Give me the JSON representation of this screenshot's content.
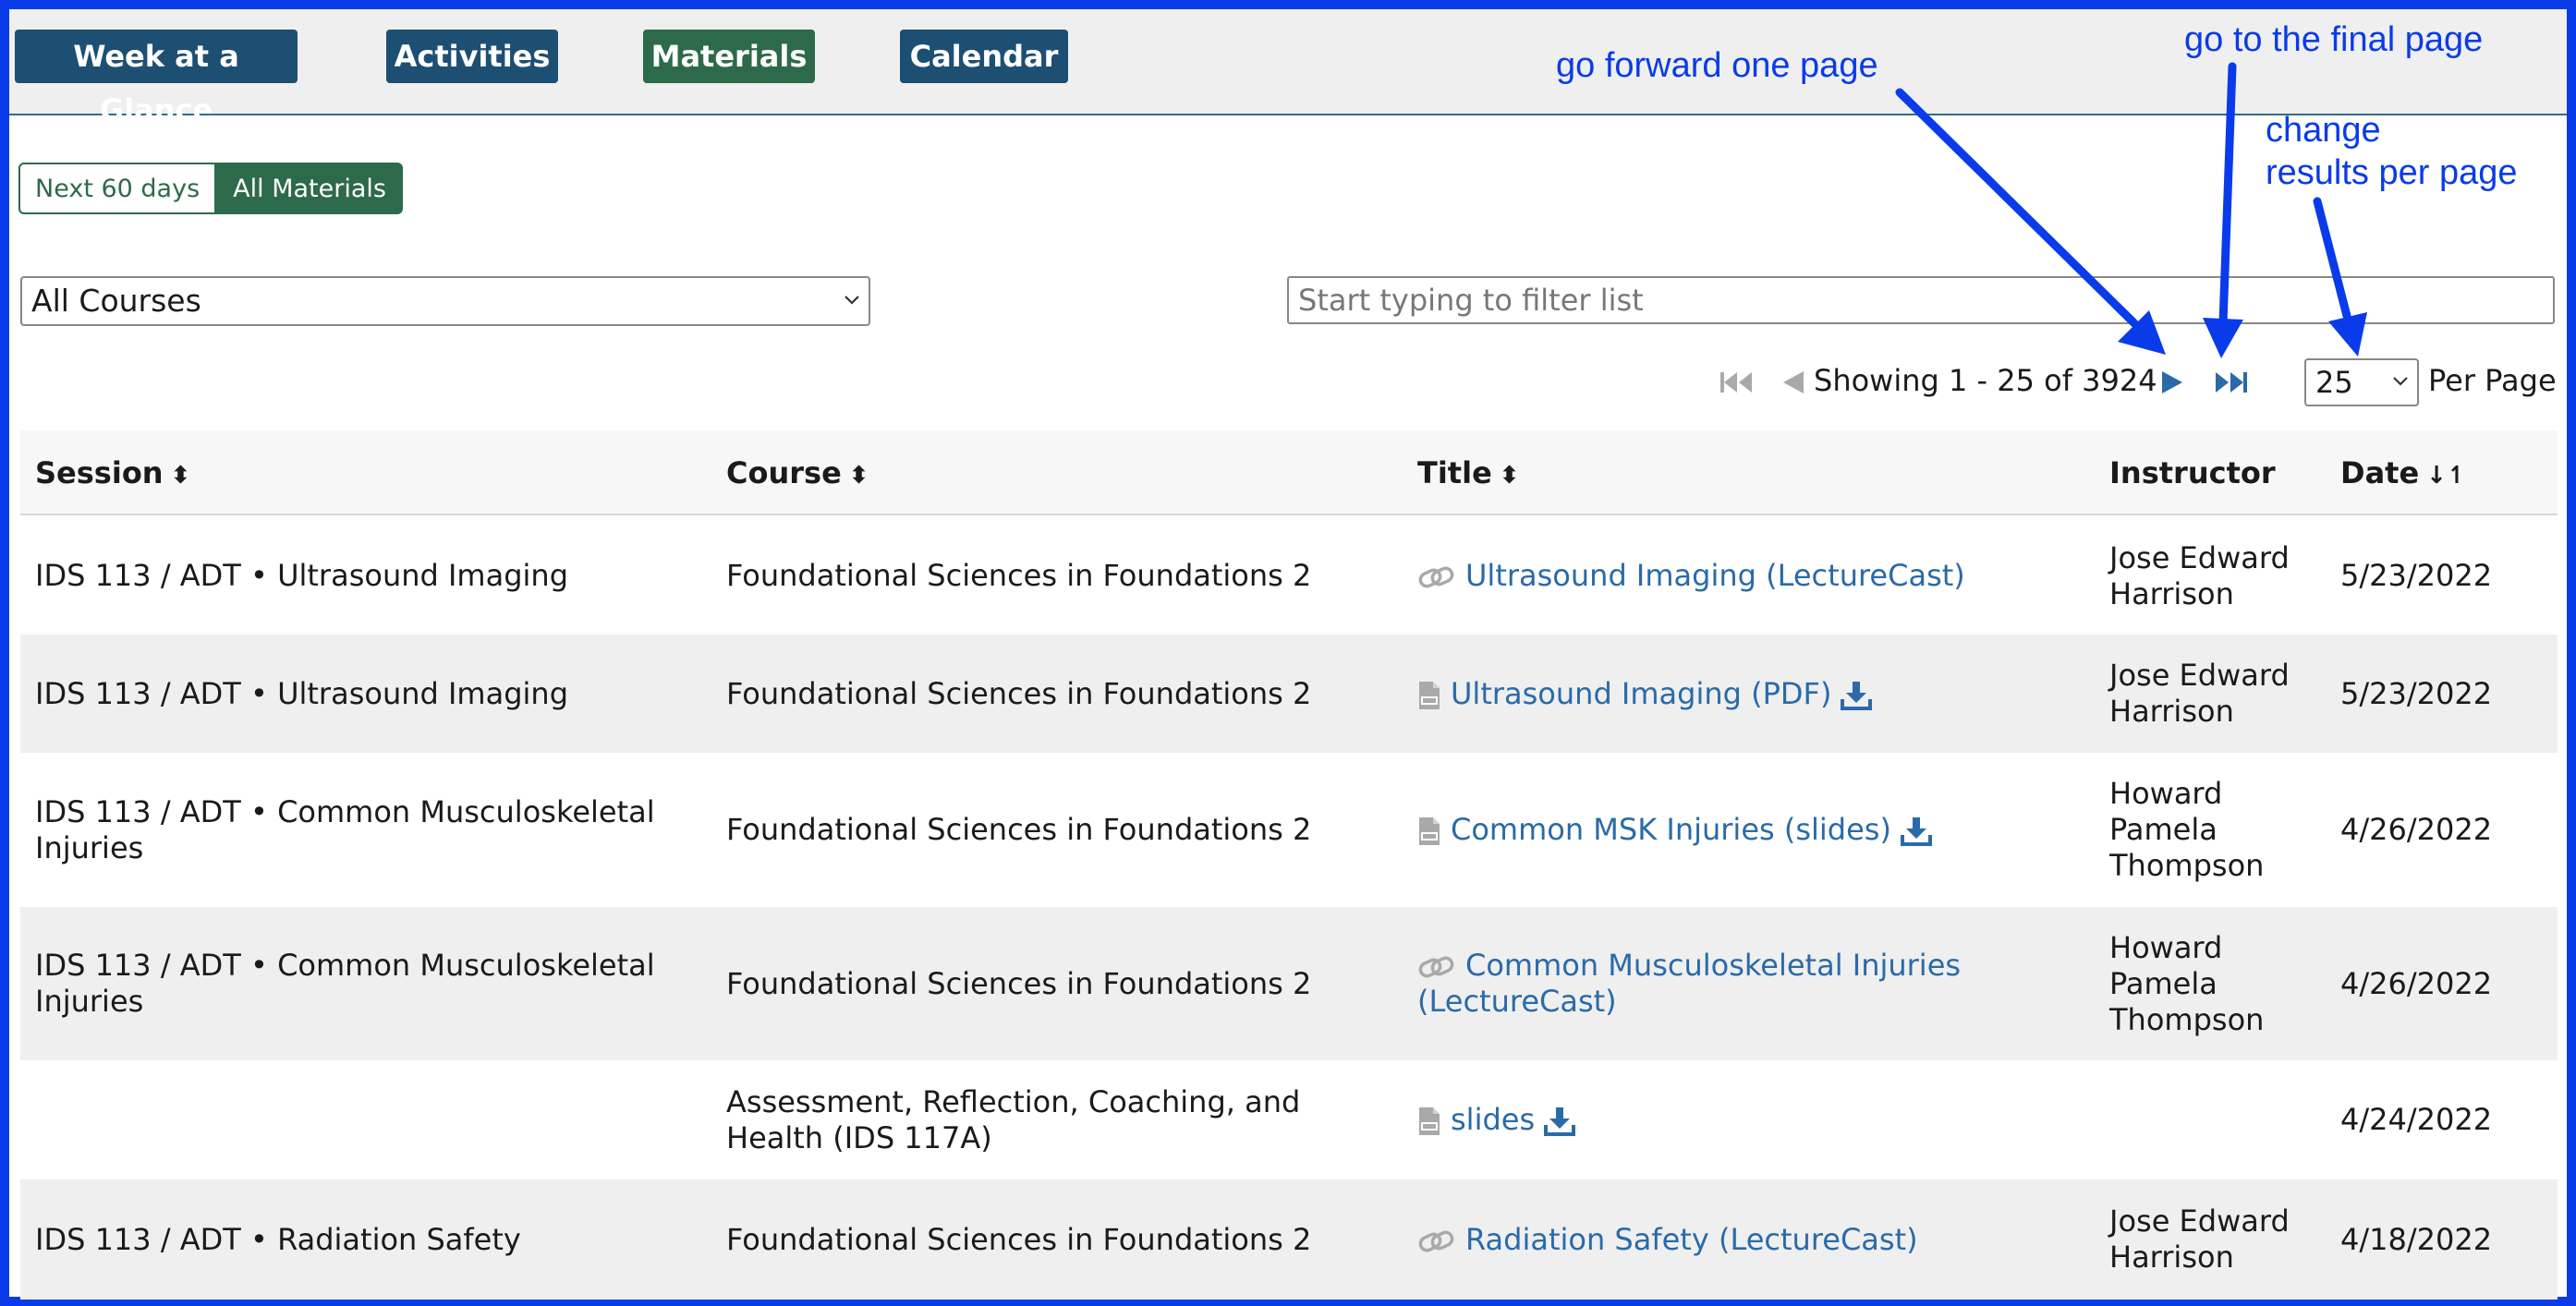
{
  "nav": {
    "week": "Week at a Glance",
    "activities": "Activities",
    "materials": "Materials",
    "calendar": "Calendar"
  },
  "toggle": {
    "next60": "Next 60 days",
    "all": "All Materials"
  },
  "course_select": {
    "value": "All Courses"
  },
  "filter": {
    "placeholder": "Start typing to filter list"
  },
  "pager": {
    "showing": "Showing 1 - 25 of 3924",
    "per_page_value": "25",
    "per_page_label": "Per Page"
  },
  "annotations": {
    "forward": "go forward one page",
    "final": "go to the final page",
    "change_line1": "change",
    "change_line2": "results per page"
  },
  "table": {
    "headers": {
      "session": "Session",
      "course": "Course",
      "title": "Title",
      "instructor": "Instructor",
      "date": "Date"
    },
    "rows": [
      {
        "session": "IDS 113 / ADT • Ultrasound Imaging",
        "course": "Foundational Sciences in Foundations 2",
        "title": "Ultrasound Imaging (LectureCast)",
        "icon": "link-icon",
        "download": false,
        "instructor": "Jose Edward Harrison",
        "date": "5/23/2022"
      },
      {
        "session": "IDS 113 / ADT • Ultrasound Imaging",
        "course": "Foundational Sciences in Foundations 2",
        "title": "Ultrasound Imaging (PDF)",
        "icon": "pdf-icon",
        "download": true,
        "instructor": "Jose Edward Harrison",
        "date": "5/23/2022"
      },
      {
        "session": "IDS 113 / ADT • Common Musculoskeletal Injuries",
        "course": "Foundational Sciences in Foundations 2",
        "title": "Common MSK Injuries (slides)",
        "icon": "pdf-icon",
        "download": true,
        "instructor": "Howard Pamela Thompson",
        "date": "4/26/2022"
      },
      {
        "session": "IDS 113 / ADT • Common Musculoskeletal Injuries",
        "course": "Foundational Sciences in Foundations 2",
        "title": "Common Musculoskeletal Injuries (LectureCast)",
        "icon": "link-icon",
        "download": false,
        "instructor": "Howard Pamela Thompson",
        "date": "4/26/2022"
      },
      {
        "session": "",
        "course": "Assessment, Reflection, Coaching, and Health (IDS 117A)",
        "title": "slides",
        "icon": "pdf-icon",
        "download": true,
        "instructor": "",
        "date": "4/24/2022"
      },
      {
        "session": "IDS 113 / ADT • Radiation Safety",
        "course": "Foundational Sciences in Foundations 2",
        "title": "Radiation Safety (LectureCast)",
        "icon": "link-icon",
        "download": false,
        "instructor": "Jose Edward Harrison",
        "date": "4/18/2022"
      }
    ]
  },
  "colors": {
    "border": "#0a3bea",
    "nav_blue": "#1d4f73",
    "nav_green": "#2d6a4a",
    "link": "#2a6aa8",
    "annotation": "#0a3bea"
  }
}
